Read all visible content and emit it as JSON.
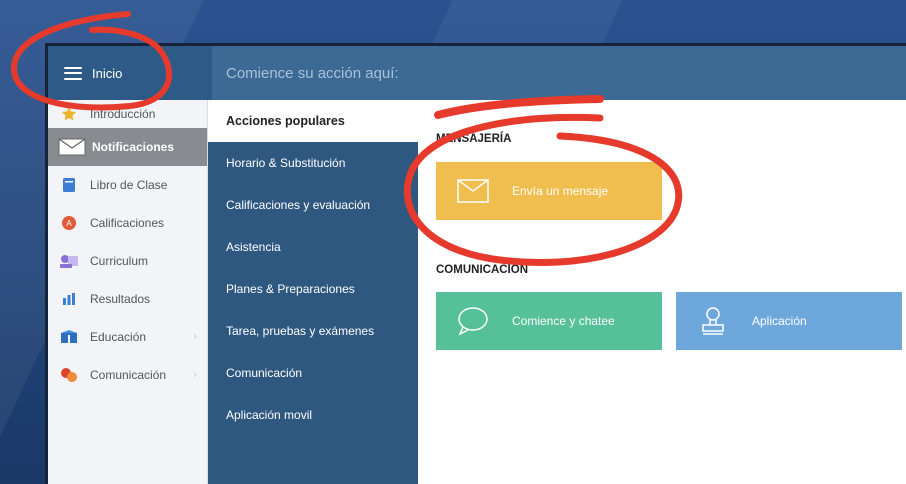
{
  "topbar": {
    "home_label": "Inicio",
    "search_placeholder": "Comience su acción aquí:"
  },
  "sidebar": {
    "items": [
      {
        "label": "Introducción",
        "icon": "star-icon"
      },
      {
        "label": "Notificaciones",
        "icon": "envelope-icon",
        "active": true
      },
      {
        "label": "Libro de Clase",
        "icon": "book-icon"
      },
      {
        "label": "Calificaciones",
        "icon": "grade-icon"
      },
      {
        "label": "Curriculum",
        "icon": "curriculum-icon"
      },
      {
        "label": "Resultados",
        "icon": "bar-chart-icon"
      },
      {
        "label": "Educación",
        "icon": "education-icon"
      },
      {
        "label": "Comunicación",
        "icon": "chat-bubbles-icon"
      }
    ]
  },
  "categories": [
    "Acciones populares",
    "Horario & Substitución",
    "Calificaciones y evaluación",
    "Asistencia",
    "Planes & Preparaciones",
    "Tarea, pruebas y exámenes",
    "Comunicación",
    "Aplicación movil"
  ],
  "main": {
    "messaging_title": "MENSAJERÍA",
    "send_message_label": "Envía un mensaje",
    "communication_title": "COMUNICACIÓN",
    "chat_label": "Comience y chatee",
    "app_label": "Aplicación"
  },
  "colors": {
    "topbar": "#3c6a94",
    "categories_bg": "#2f5880",
    "message_tile": "#f0be4f",
    "chat_tile": "#56c198",
    "app_tile": "#6ea7dc",
    "annotation": "#e63a2c"
  }
}
